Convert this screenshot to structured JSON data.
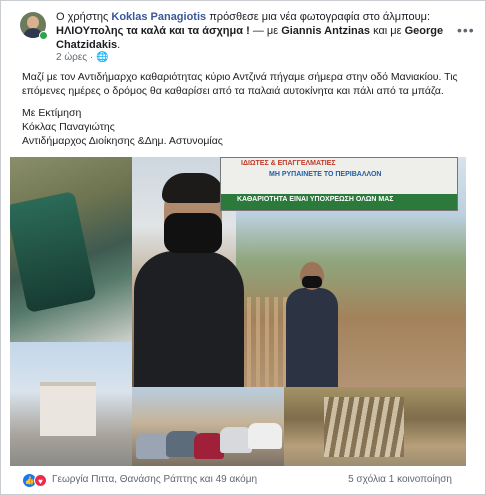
{
  "post": {
    "header_intro": "Ο χρήστης",
    "author": "Koklas Panagiotis",
    "action": "πρόσθεσε μια νέα φωτογραφία στο άλμπουμ:",
    "album": "ΗΛΙΟΥπολης τα καλά και τα άσχημα !",
    "with_prefix": "— με",
    "tagged1": "Giannis Antzinas",
    "conj": "και με",
    "tagged2": "George Chatzidakis",
    "period": ".",
    "time": "2 ώρες",
    "privacy_sep": "·",
    "more_label": "•••",
    "body": {
      "line1": "Μαζί με τον Αντιδήμαρχο καθαριότητας κύριο Αντζινά πήγαμε σήμερα στην οδό Μανιακίου. Τις επόμενες ημέρες ο δρόμος θα καθαρίσει από τα παλαιά αυτοκίνητα και πάλι από τα μπάζα.",
      "sig1": "Με Εκτίμηση",
      "sig2": "Κόκλας Παναγιώτης",
      "sig3": "Αντιδήμαρχος Διοίκησης &Δημ. Αστυνομίας"
    },
    "banner": {
      "line1": "ΙΔΙΩΤΕΣ & ΕΠΑΓΓΕΛΜΑΤΙΕΣ",
      "line2": "ΜΗ ΡΥΠΑΙΝΕΤΕ ΤΟ ΠΕΡΙΒΑΛΛΟΝ",
      "line4": "ΚΑΘΑΡΙΟΤΗΤΑ ΕΙΝΑΙ ΥΠΟΧΡΕΩΣΗ ΟΛΩΝ ΜΑΣ"
    }
  },
  "footer": {
    "like_icon": "like-icon",
    "love_icon": "love-icon",
    "reactors": "Γεωργία Πιττα, Θανάσης Ράπτης και 49 ακόμη",
    "comments": "5 σχόλια",
    "shares": "1 κοινοποίηση"
  },
  "colors": {
    "link": "#385898",
    "like": "#1877f2",
    "love": "#f0284a",
    "online": "#31a24c"
  }
}
